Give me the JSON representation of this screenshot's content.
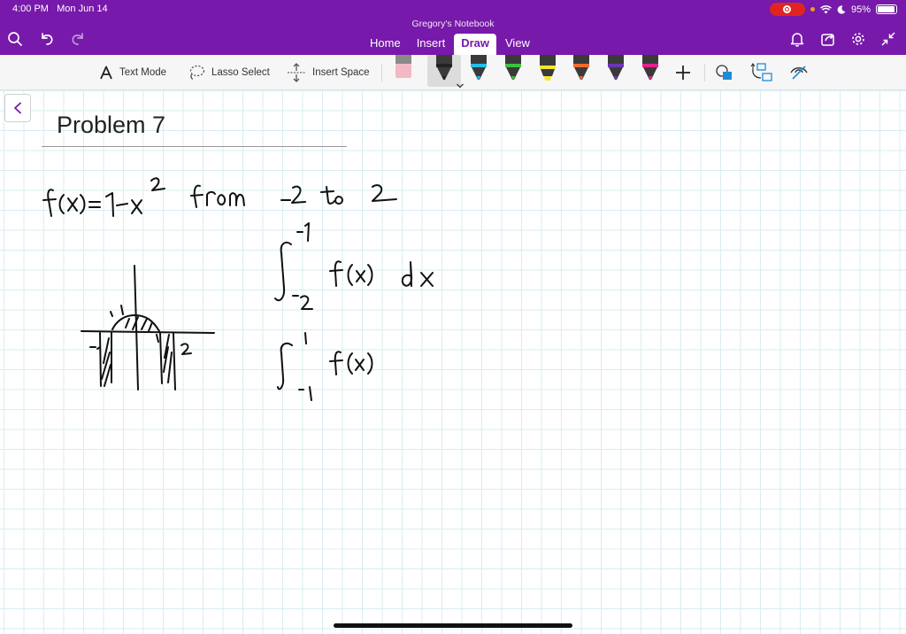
{
  "status": {
    "time": "4:00 PM",
    "date": "Mon Jun 14",
    "battery": "95%",
    "battery_level": 0.95
  },
  "notebook": {
    "title": "Gregory's Notebook"
  },
  "tabs": [
    {
      "label": "Home",
      "active": false
    },
    {
      "label": "Insert",
      "active": false
    },
    {
      "label": "Draw",
      "active": true
    },
    {
      "label": "View",
      "active": false
    }
  ],
  "ribbon": {
    "text_mode": "Text Mode",
    "lasso_select": "Lasso Select",
    "insert_space": "Insert Space"
  },
  "pens": [
    {
      "name": "eraser",
      "color": "#f2b8c6"
    },
    {
      "name": "black-pen",
      "color": "#222222",
      "selected": true
    },
    {
      "name": "cyan-pen",
      "color": "#22c0e8"
    },
    {
      "name": "green-pen",
      "color": "#3cc33c"
    },
    {
      "name": "yellow-highlighter",
      "color": "#f7e62a"
    },
    {
      "name": "orange-pen",
      "color": "#f26a2e"
    },
    {
      "name": "purple-pen",
      "color": "#6a36b8"
    },
    {
      "name": "magenta-pen",
      "color": "#e8218a"
    }
  ],
  "page": {
    "title": "Problem 7"
  },
  "colors": {
    "header": "#7719aa",
    "grid": "#d9edf2",
    "ink": "#111111"
  }
}
